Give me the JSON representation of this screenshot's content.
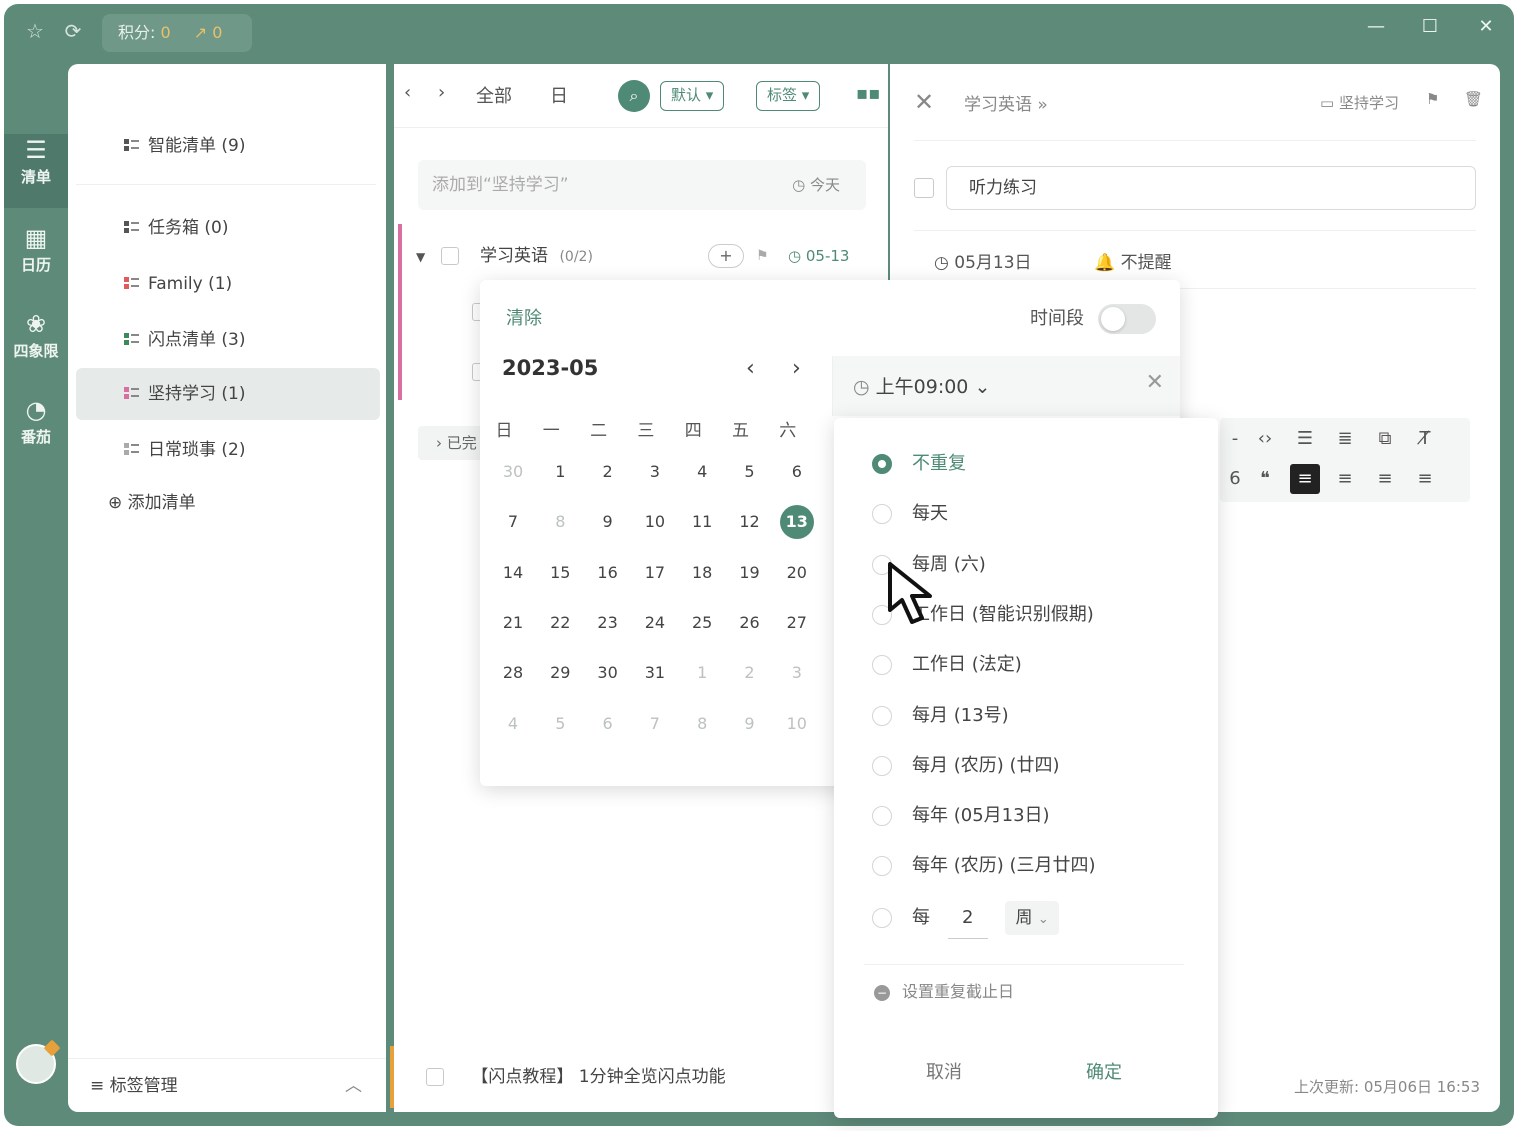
{
  "titlebar": {
    "points_label": "积分:",
    "points_value": "0",
    "trend_value": "0",
    "icons": [
      "pin-icon",
      "refresh-icon",
      "trend-icon",
      "minimize-icon",
      "maximize-icon",
      "close-icon"
    ]
  },
  "rail": [
    {
      "label": "清单",
      "icon": "list-icon",
      "active": true
    },
    {
      "label": "日历",
      "icon": "calendar-icon",
      "active": false
    },
    {
      "label": "四象限",
      "icon": "quadrant-icon",
      "active": false
    },
    {
      "label": "番茄",
      "icon": "tomato-icon",
      "active": false
    }
  ],
  "sidebar": {
    "items": [
      {
        "label": "智能清单 (9)"
      },
      {
        "label": "任务箱 (0)"
      },
      {
        "label": "Family (1)"
      },
      {
        "label": "闪点清单 (3)"
      },
      {
        "label": "坚持学习 (1)"
      },
      {
        "label": "日常琐事 (2)"
      }
    ],
    "add_list": "添加清单",
    "tag_manage": "标签管理"
  },
  "middle": {
    "filter_all": "全部",
    "filter_day": "日",
    "sort_default": "默认",
    "tag_button": "标签",
    "add_placeholder": "添加到“坚持学习”",
    "add_today": "今天",
    "task_title": "学习英语",
    "task_count": "(0/2)",
    "task_date": "05-13",
    "completed_label": "已完",
    "bottom_task": "【闪点教程】 1分钟全览闪点功能"
  },
  "detail": {
    "breadcrumb": "学习英语",
    "list_name": "坚持学习",
    "subtask_title": "听力练习",
    "date": "05月13日",
    "reminder": "不提醒",
    "last_updated": "上次更新: 05月06日 16:53"
  },
  "date_picker": {
    "clear": "清除",
    "time_range": "时间段",
    "month": "2023-05",
    "weekdays": [
      "日",
      "一",
      "二",
      "三",
      "四",
      "五",
      "六"
    ],
    "weeks": [
      [
        "30",
        "1",
        "2",
        "3",
        "4",
        "5",
        "6"
      ],
      [
        "7",
        "8",
        "9",
        "10",
        "11",
        "12",
        "13"
      ],
      [
        "14",
        "15",
        "16",
        "17",
        "18",
        "19",
        "20"
      ],
      [
        "21",
        "22",
        "23",
        "24",
        "25",
        "26",
        "27"
      ],
      [
        "28",
        "29",
        "30",
        "31",
        "1",
        "2",
        "3"
      ],
      [
        "4",
        "5",
        "6",
        "7",
        "8",
        "9",
        "10"
      ]
    ],
    "selected_day": "13",
    "time": "上午09:00"
  },
  "repeat": {
    "options": [
      "不重复",
      "每天",
      "每周 (六)",
      "工作日 (智能识别假期)",
      "工作日 (法定)",
      "每月 (13号)",
      "每月 (农历) (廿四)",
      "每年 (05月13日)",
      "每年 (农历) (三月廿四)"
    ],
    "selected_index": 0,
    "custom_prefix": "每",
    "custom_number": "2",
    "custom_unit": "周",
    "end_date": "设置重复截止日",
    "cancel": "取消",
    "confirm": "确定"
  },
  "colors": {
    "accent": "#4f8a76",
    "frame": "#5e8a7a",
    "pink": "#d86fa0",
    "orange": "#e8a03a"
  }
}
